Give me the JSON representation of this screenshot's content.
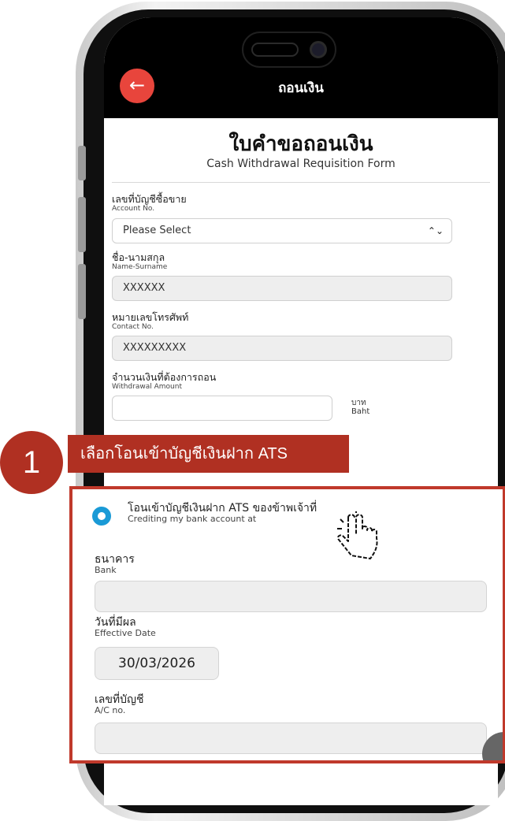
{
  "header": {
    "title": "ถอนเงิน",
    "back_icon": "←"
  },
  "form": {
    "title": "ใบคำขอถอนเงิน",
    "subtitle": "Cash Withdrawal Requisition Form",
    "account": {
      "label_th": "เลขที่บัญชีซื้อขาย",
      "label_en": "Account No.",
      "value": "Please Select",
      "arrows": "⌃⌄"
    },
    "name": {
      "label_th": "ชื่อ-นามสกุล",
      "label_en": "Name-Surname",
      "value": "XXXXXX"
    },
    "contact": {
      "label_th": "หมายเลขโทรศัพท์",
      "label_en": "Contact No.",
      "value": "XXXXXXXXX"
    },
    "amount": {
      "label_th": "จำนวนเงินที่ต้องการถอน",
      "label_en": "Withdrawal Amount",
      "value": "",
      "unit_th": "บาท",
      "unit_en": "Baht"
    }
  },
  "callout": {
    "number": "1",
    "text": "เลือกโอนเข้าบัญชีเงินฝาก ATS"
  },
  "zoom": {
    "radio_label_th": "โอนเข้าบัญชีเงินฝาก ATS ของข้าพเจ้าที่",
    "radio_label_en": "Crediting my bank account at",
    "bank_th": "ธนาคาร",
    "bank_en": "Bank",
    "bank_value": "",
    "date_th": "วันที่มีผล",
    "date_en": "Effective Date",
    "date_value": "30/03/2026",
    "acno_th": "เลขที่บัญชี",
    "acno_en": "A/C no.",
    "acno_value": ""
  },
  "colors": {
    "accent_red": "#b03022",
    "back_button": "#e8453c",
    "radio_blue": "#1a9ad6"
  },
  "icons": [
    "arrow-left-icon",
    "select-arrows-icon",
    "pointer-hand-icon"
  ]
}
